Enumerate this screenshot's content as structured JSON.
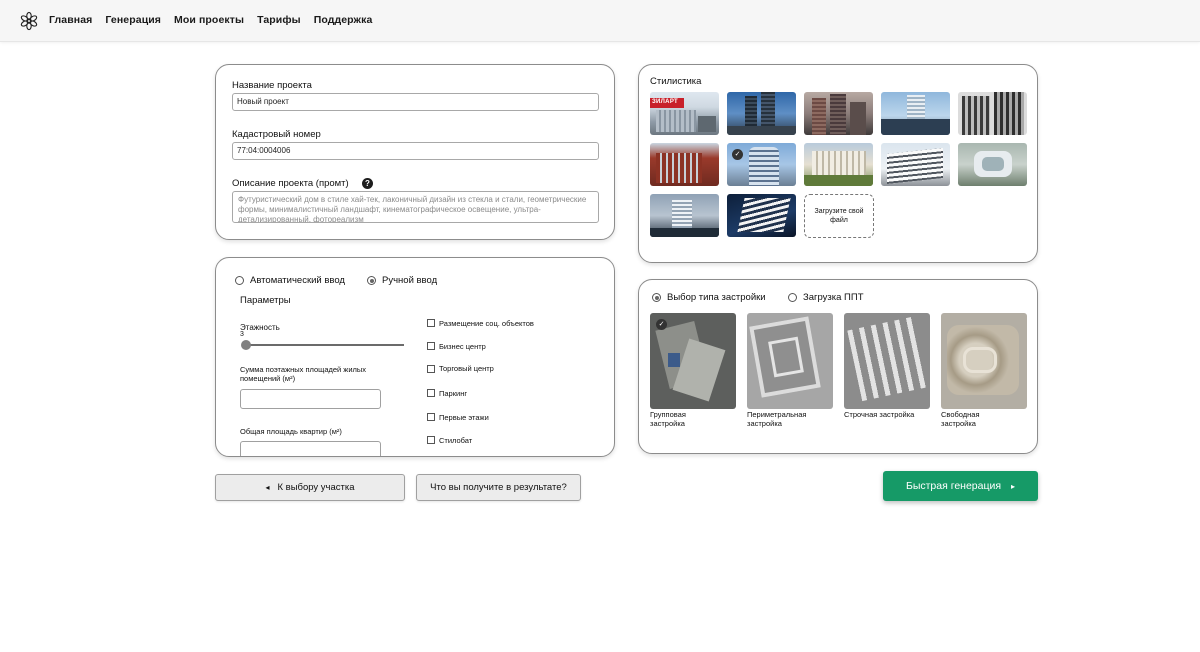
{
  "header": {
    "logo_icon": "snowflake-logo-icon",
    "nav": [
      "Главная",
      "Генерация",
      "Мои проекты",
      "Тарифы",
      "Поддержка"
    ]
  },
  "project": {
    "name_label": "Название проекта",
    "name_value": "Новый проект",
    "cadastral_label": "Кадастровый номер",
    "cadastral_value": "77:04:0004006",
    "description_label": "Описание проекта (промт)",
    "help_icon": "?",
    "description_placeholder": "Футуристический дом в стиле хай-тек, лаконичный дизайн из стекла и стали, геометрические формы, минималистичный ландшафт, кинематографическое освещение, ультра-детализированный, фотореализм"
  },
  "params": {
    "mode_auto": "Автоматический ввод",
    "mode_manual": "Ручной ввод",
    "selected_mode": "manual",
    "title": "Параметры",
    "floors_label": "Этажность",
    "floors_value": "3",
    "floors_fraction": 0.0,
    "living_area_label": "Сумма поэтажных площадей жилых помещений (м²)",
    "total_area_label": "Общая площадь квартир (м²)",
    "checkboxes": [
      "Размещение соц. объектов",
      "Бизнес центр",
      "Торговый центр",
      "Паркинг",
      "Первые этажи",
      "Стилобат"
    ]
  },
  "style": {
    "title": "Стилистика",
    "brand_overlay": "ЗИЛАРТ",
    "upload_label": "Загрузите свой файл",
    "selected_index": 6,
    "check_icon": "✓"
  },
  "building": {
    "mode_type": "Выбор типа застройки",
    "mode_ppt": "Загрузка ППТ",
    "selected_mode": "type",
    "types": [
      "Групповая застройка",
      "Периметральная застройка",
      "Строчная застройка",
      "Свободная застройка"
    ],
    "selected_type": 0,
    "check_icon": "✓"
  },
  "actions": {
    "back_arrow": "◂",
    "back_label": "К выбору участка",
    "result_label": "Что вы получите в результате?",
    "generate_label": "Быстрая генерация",
    "generate_arrow": "▸"
  },
  "colors": {
    "accent_green": "#169a67",
    "border": "#8c8c8c"
  }
}
